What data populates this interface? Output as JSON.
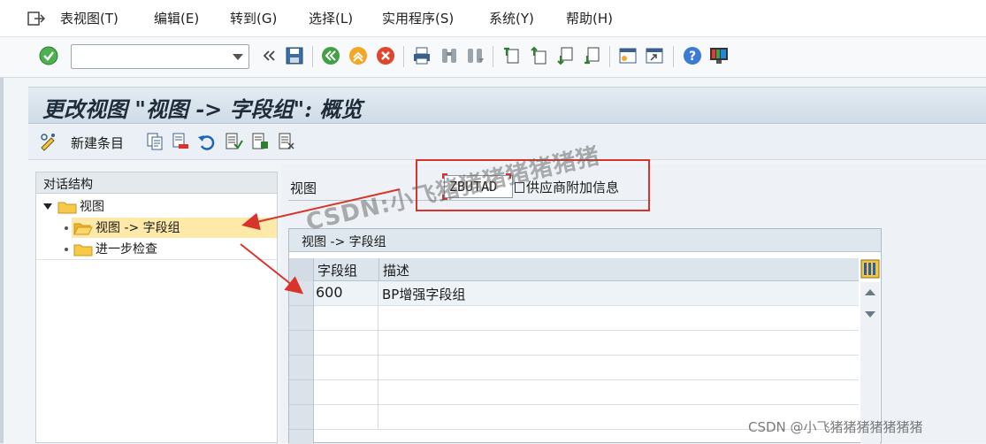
{
  "menu": {
    "items": [
      {
        "label": "表视图(T)"
      },
      {
        "label": "编辑(E)"
      },
      {
        "label": "转到(G)"
      },
      {
        "label": "选择(L)"
      },
      {
        "label": "实用程序(S)"
      },
      {
        "label": "系统(Y)"
      },
      {
        "label": "帮助(H)"
      }
    ]
  },
  "toolbar": {
    "command_field_value": "",
    "icons": [
      "check-icon",
      "command-field",
      "back-arrows-icon",
      "save-icon",
      "back-icon",
      "exit-icon",
      "cancel-icon",
      "print-icon",
      "find-icon",
      "find-next-icon",
      "first-page-icon",
      "previous-page-icon",
      "next-page-icon",
      "last-page-icon",
      "new-session-icon",
      "shortcut-icon",
      "help-icon",
      "layout-icon"
    ]
  },
  "title": {
    "text": "更改视图 \"视图 -> 字段组\": 概览"
  },
  "app_toolbar": {
    "new_entries_label": "新建条目"
  },
  "left_panel": {
    "header": "对话结构",
    "tree": [
      {
        "label": "视图",
        "level": 0,
        "expanded": true
      },
      {
        "label": "视图 -> 字段组",
        "level": 1,
        "selected": true
      },
      {
        "label": "进一步检查",
        "level": 1,
        "selected": false
      }
    ]
  },
  "right_panel": {
    "view_label": "视图",
    "view_value": "ZBUTAD",
    "view_description": "供应商附加信息"
  },
  "table": {
    "title": "视图 -> 字段组",
    "columns": [
      "字段组",
      "描述"
    ],
    "rows": [
      {
        "field_group": "600",
        "description": "BP增强字段组"
      }
    ],
    "empty_rows": 5
  },
  "watermarks": {
    "diagonal": "CSDN:小飞猪猪猪猪猪猪猪",
    "corner": "CSDN @小飞猪猪猪猪猪猪猪"
  },
  "colors": {
    "annotation_red": "#d9342b",
    "selection_yellow": "#ffe9a8",
    "title_band": "#d6e1eb"
  }
}
